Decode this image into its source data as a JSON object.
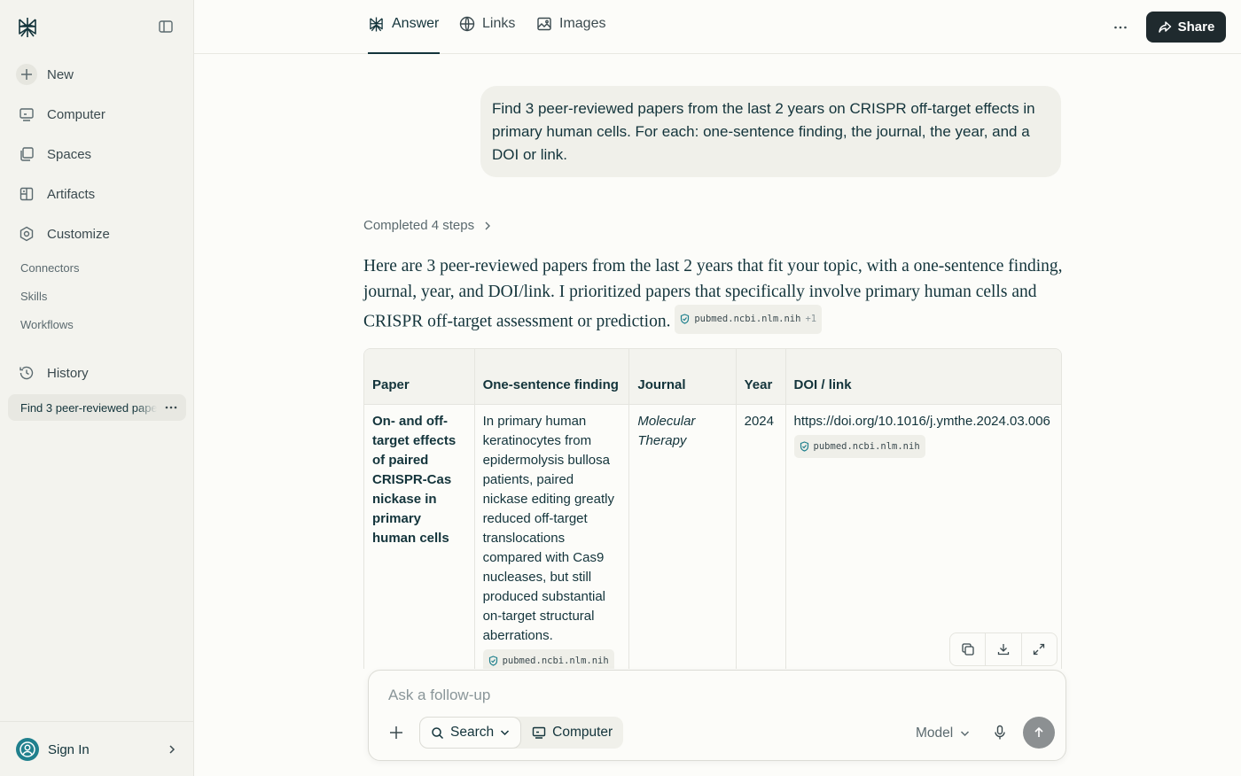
{
  "sidebar": {
    "new_label": "New",
    "items": [
      {
        "label": "Computer"
      },
      {
        "label": "Spaces"
      },
      {
        "label": "Artifacts"
      },
      {
        "label": "Customize"
      }
    ],
    "sub_items": [
      "Connectors",
      "Skills",
      "Workflows"
    ],
    "history_label": "History",
    "thread_label": "Find 3 peer-reviewed papers from the last 2 years on CRISPR off-target effects in primary human cells",
    "signin_label": "Sign In"
  },
  "header": {
    "tabs": [
      "Answer",
      "Links",
      "Images"
    ],
    "share_label": "Share"
  },
  "query": "Find 3 peer-reviewed papers from the last 2 years on CRISPR off-target effects in primary human cells. For each: one-sentence finding, the journal, the year, and a DOI or link.",
  "steps_label": "Completed 4 steps",
  "answer_text": "Here are 3 peer-reviewed papers from the last 2 years that fit your topic, with a one-sentence finding, journal, year, and DOI/link. I prioritized papers that specifically involve primary human cells and CRISPR off-target assessment or prediction.",
  "answer_cite": {
    "source": "pubmed.ncbi.nlm.nih",
    "extra": "+1"
  },
  "table": {
    "headers": [
      "Paper",
      "One-sentence finding",
      "Journal",
      "Year",
      "DOI / link"
    ],
    "rows": [
      {
        "paper": "On- and off-target effects of paired CRISPR-Cas nickase in primary human cells",
        "finding": "In primary human keratinocytes from epidermolysis bullosa patients, paired nickase editing greatly reduced off-target translocations compared with Cas9 nucleases, but still produced substantial on-target structural aberrations.",
        "finding_cite": "pubmed.ncbi.nlm.nih",
        "journal": "Molecular Therapy",
        "year": "2024",
        "doi": "https://doi.org/10.1016/j.ymthe.2024.03.006",
        "doi_cite": "pubmed.ncbi.nlm.nih"
      }
    ]
  },
  "input": {
    "placeholder": "Ask a follow-up",
    "search_label": "Search",
    "computer_label": "Computer",
    "model_label": "Model"
  },
  "colors": {
    "accent": "#20808d",
    "share_bg": "#1f2a2e",
    "send_bg": "#8c9092",
    "cite_check": "#20808d"
  }
}
